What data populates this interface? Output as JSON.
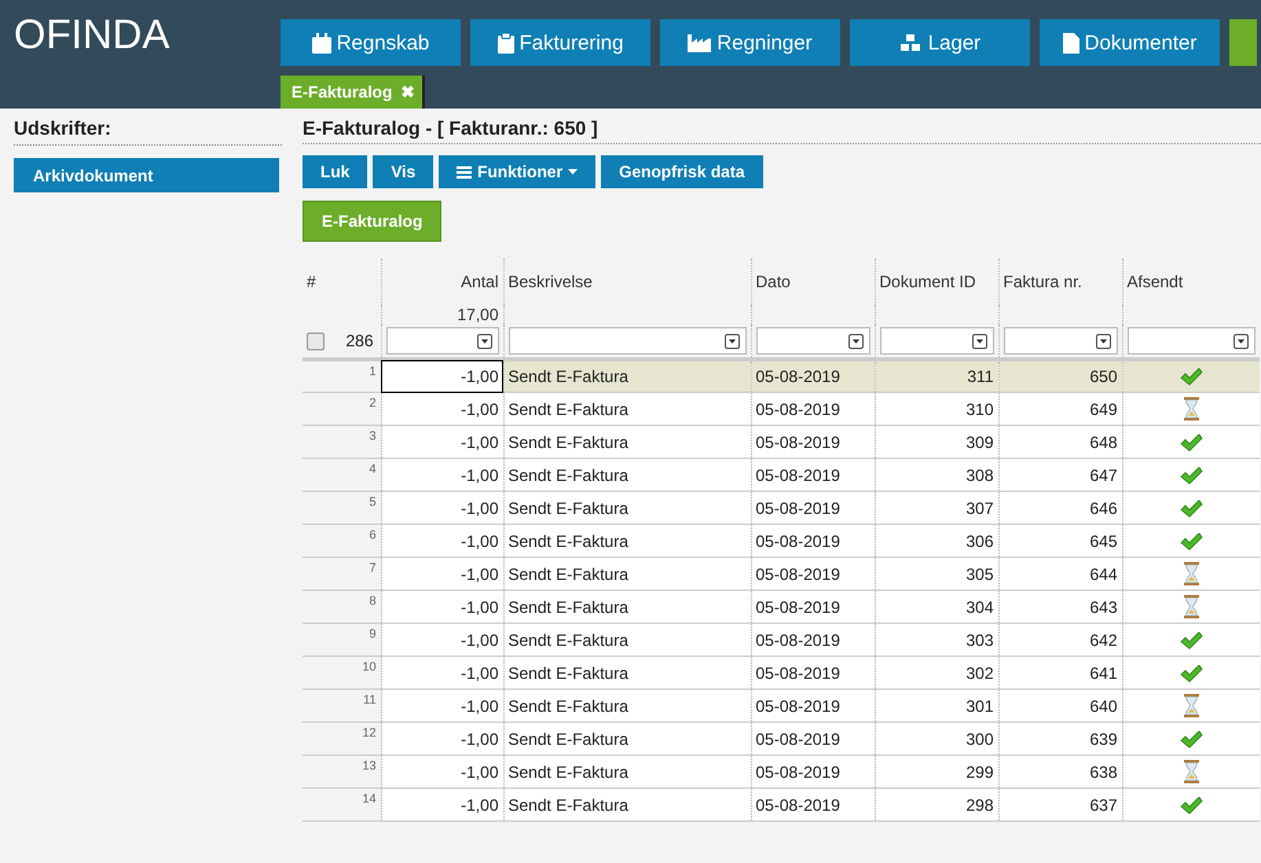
{
  "logo": "OFINDA",
  "nav": [
    {
      "label": "Regnskab"
    },
    {
      "label": "Fakturering"
    },
    {
      "label": "Regninger"
    },
    {
      "label": "Lager"
    },
    {
      "label": "Dokumenter"
    }
  ],
  "open_tab": {
    "label": "E-Fakturalog",
    "close": "✖"
  },
  "sidebar": {
    "title": "Udskrifter:",
    "items": [
      "Arkivdokument"
    ]
  },
  "page_title": "E-Fakturalog - [ Fakturanr.: 650 ]",
  "toolbar": [
    {
      "label": "Luk",
      "kind": "plain"
    },
    {
      "label": "Vis",
      "kind": "plain"
    },
    {
      "label": "Funktioner",
      "kind": "menu"
    },
    {
      "label": "Genopfrisk data",
      "kind": "plain"
    }
  ],
  "view_button": "E-Fakturalog",
  "table": {
    "columns": [
      "#",
      "Antal",
      "Beskrivelse",
      "Dato",
      "Dokument ID",
      "Faktura nr.",
      "Afsendt"
    ],
    "total": "17,00",
    "row_count": "286",
    "select_all": {
      "checked": false
    },
    "rows": [
      {
        "n": "1",
        "antal": "-1,00",
        "beskrivelse": "Sendt E-Faktura",
        "dato": "05-08-2019",
        "dokument_id": "311",
        "faktura_nr": "650",
        "sent": true,
        "selected": true
      },
      {
        "n": "2",
        "antal": "-1,00",
        "beskrivelse": "Sendt E-Faktura",
        "dato": "05-08-2019",
        "dokument_id": "310",
        "faktura_nr": "649",
        "sent": false,
        "selected": false
      },
      {
        "n": "3",
        "antal": "-1,00",
        "beskrivelse": "Sendt E-Faktura",
        "dato": "05-08-2019",
        "dokument_id": "309",
        "faktura_nr": "648",
        "sent": true,
        "selected": false
      },
      {
        "n": "4",
        "antal": "-1,00",
        "beskrivelse": "Sendt E-Faktura",
        "dato": "05-08-2019",
        "dokument_id": "308",
        "faktura_nr": "647",
        "sent": true,
        "selected": false
      },
      {
        "n": "5",
        "antal": "-1,00",
        "beskrivelse": "Sendt E-Faktura",
        "dato": "05-08-2019",
        "dokument_id": "307",
        "faktura_nr": "646",
        "sent": true,
        "selected": false
      },
      {
        "n": "6",
        "antal": "-1,00",
        "beskrivelse": "Sendt E-Faktura",
        "dato": "05-08-2019",
        "dokument_id": "306",
        "faktura_nr": "645",
        "sent": true,
        "selected": false
      },
      {
        "n": "7",
        "antal": "-1,00",
        "beskrivelse": "Sendt E-Faktura",
        "dato": "05-08-2019",
        "dokument_id": "305",
        "faktura_nr": "644",
        "sent": false,
        "selected": false
      },
      {
        "n": "8",
        "antal": "-1,00",
        "beskrivelse": "Sendt E-Faktura",
        "dato": "05-08-2019",
        "dokument_id": "304",
        "faktura_nr": "643",
        "sent": false,
        "selected": false
      },
      {
        "n": "9",
        "antal": "-1,00",
        "beskrivelse": "Sendt E-Faktura",
        "dato": "05-08-2019",
        "dokument_id": "303",
        "faktura_nr": "642",
        "sent": true,
        "selected": false
      },
      {
        "n": "10",
        "antal": "-1,00",
        "beskrivelse": "Sendt E-Faktura",
        "dato": "05-08-2019",
        "dokument_id": "302",
        "faktura_nr": "641",
        "sent": true,
        "selected": false
      },
      {
        "n": "11",
        "antal": "-1,00",
        "beskrivelse": "Sendt E-Faktura",
        "dato": "05-08-2019",
        "dokument_id": "301",
        "faktura_nr": "640",
        "sent": false,
        "selected": false
      },
      {
        "n": "12",
        "antal": "-1,00",
        "beskrivelse": "Sendt E-Faktura",
        "dato": "05-08-2019",
        "dokument_id": "300",
        "faktura_nr": "639",
        "sent": true,
        "selected": false
      },
      {
        "n": "13",
        "antal": "-1,00",
        "beskrivelse": "Sendt E-Faktura",
        "dato": "05-08-2019",
        "dokument_id": "299",
        "faktura_nr": "638",
        "sent": false,
        "selected": false
      },
      {
        "n": "14",
        "antal": "-1,00",
        "beskrivelse": "Sendt E-Faktura",
        "dato": "05-08-2019",
        "dokument_id": "298",
        "faktura_nr": "637",
        "sent": true,
        "selected": false
      }
    ]
  }
}
